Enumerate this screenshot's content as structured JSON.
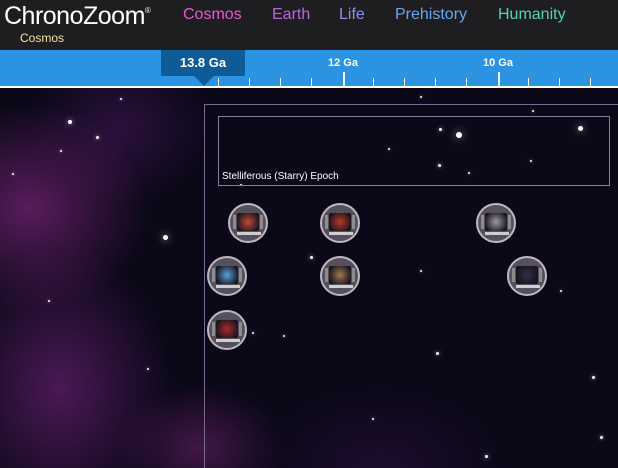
{
  "app": {
    "logo_text": "ChronoZoom",
    "logo_mark": "®",
    "breadcrumb": "Cosmos"
  },
  "nav": [
    {
      "label": "Cosmos",
      "color": "#e659d9"
    },
    {
      "label": "Earth",
      "color": "#b666de"
    },
    {
      "label": "Life",
      "color": "#8a8ff2"
    },
    {
      "label": "Prehistory",
      "color": "#6aa5ef"
    },
    {
      "label": "Humanity",
      "color": "#56d2b2"
    }
  ],
  "timescale": {
    "current_marker": "13.8 Ga",
    "tick_labels": [
      "12 Ga",
      "10 Ga"
    ],
    "bar_color": "#2a94e2"
  },
  "canvas": {
    "epoch_title": "Stelliferous (Starry) Epoch"
  },
  "artifacts": [
    {
      "name": "artifact-spiral-galaxy",
      "accent": "#c04a3a"
    },
    {
      "name": "artifact-red-nebula",
      "accent": "#b83a22"
    },
    {
      "name": "artifact-star-burst",
      "accent": "#9a9aa6"
    },
    {
      "name": "artifact-heat-map",
      "accent": "#5aa0d8"
    },
    {
      "name": "artifact-landscape",
      "accent": "#a07850"
    },
    {
      "name": "artifact-dark-galaxy",
      "accent": "#303046"
    },
    {
      "name": "artifact-red-sky",
      "accent": "#a82c2c"
    }
  ]
}
